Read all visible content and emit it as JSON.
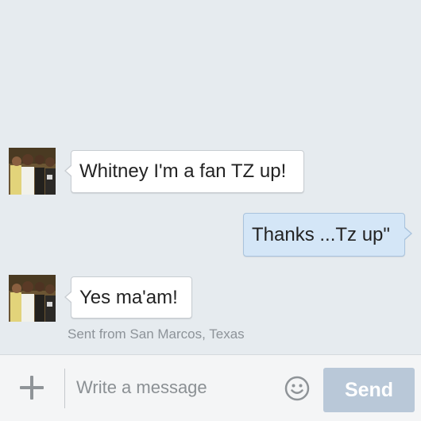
{
  "thread": {
    "messages": [
      {
        "direction": "incoming",
        "text": "Whitney I'm a fan TZ up!",
        "avatar": "profile-photo"
      },
      {
        "direction": "outgoing",
        "text": "Thanks ...Tz up\""
      },
      {
        "direction": "incoming",
        "text": "Yes ma'am!",
        "avatar": "profile-photo"
      }
    ],
    "location_note": "Sent from San Marcos, Texas"
  },
  "composer": {
    "attach_icon": "plus-icon",
    "placeholder": "Write a message",
    "emoji_icon": "smiley-icon",
    "send_label": "Send"
  },
  "colors": {
    "background": "#e6ebef",
    "incoming_bubble": "#ffffff",
    "outgoing_bubble": "#d4e6f7",
    "send_button_disabled": "#b9c8d8"
  }
}
